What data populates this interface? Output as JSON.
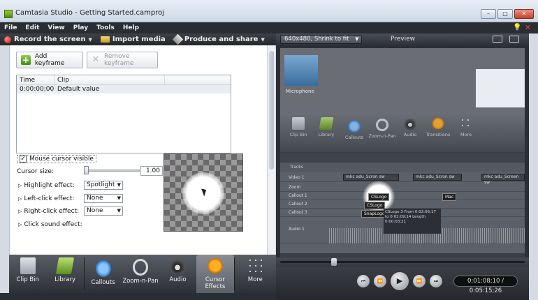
{
  "window": {
    "title": "Camtasia Studio - Getting Started.camproj",
    "buttons": {
      "minimize": "–",
      "maximize": "□",
      "close": "✕"
    }
  },
  "menubar": {
    "items": [
      "File",
      "Edit",
      "View",
      "Play",
      "Tools",
      "Help"
    ]
  },
  "toolbar": {
    "record": "Record the screen",
    "import": "Import media",
    "produce": "Produce and share"
  },
  "keyframes": {
    "add_label": "Add keyframe",
    "remove_label": "Remove keyframe",
    "columns": [
      "Time",
      "Clip"
    ],
    "rows": [
      {
        "time": "0:00:00;00",
        "clip": "Default value"
      }
    ]
  },
  "cursor_effects": {
    "mouse_visible_label": "Mouse cursor visible",
    "mouse_visible_checked": true,
    "size_label": "Cursor size:",
    "size_value": "1.00",
    "size_level": 0.0,
    "highlight_label": "Highlight effect:",
    "highlight_value": "Spotlight",
    "left_click_label": "Left-click effect:",
    "left_click_value": "None",
    "right_click_label": "Right-click effect:",
    "right_click_value": "None",
    "sound_label": "Click sound effect:"
  },
  "left_tabs": [
    {
      "name": "clip-bin",
      "label": "Clip Bin"
    },
    {
      "name": "library",
      "label": "Library"
    },
    {
      "name": "callouts",
      "label": "Callouts"
    },
    {
      "name": "zoom-n-pan",
      "label": "Zoom-n-Pan"
    },
    {
      "name": "audio",
      "label": "Audio"
    },
    {
      "name": "cursor-effects",
      "label": "Cursor Effects",
      "active": true
    },
    {
      "name": "more",
      "label": "More"
    }
  ],
  "preview": {
    "size_dropdown": "640x480, Shrink to fit",
    "title": "Preview",
    "time_display": "0:01:08;10 / 0:05:15;26",
    "playhead_fraction": 0.22
  },
  "preview_capture": {
    "tile_label": "Microphone",
    "tabs": [
      "Clip Bin",
      "Library",
      "Callouts",
      "Zoom-n-Pan",
      "Audio",
      "Transitions",
      "More"
    ],
    "tracks": [
      "Video 1",
      "Zoom",
      "Callout 1",
      "Callout 2",
      "Callout 3",
      "Audio 1"
    ],
    "clip_labels": [
      "mkc adu_Scron sw",
      "mkc adu_Scron sw",
      "mkc adu_Screen sw"
    ],
    "tags": [
      "CSLogo",
      "CSLogo",
      "SnapLogo",
      "Mac"
    ],
    "tooltip": "CSLogo 3 From 0:02:06;17 to 0:02:09;14 Length 0:00:03;21",
    "tracks_label": "Tracks"
  },
  "colors": {
    "active_tab": "#7d828a",
    "record": "#d32a15",
    "cursor_icon": "#ff9d1a"
  }
}
